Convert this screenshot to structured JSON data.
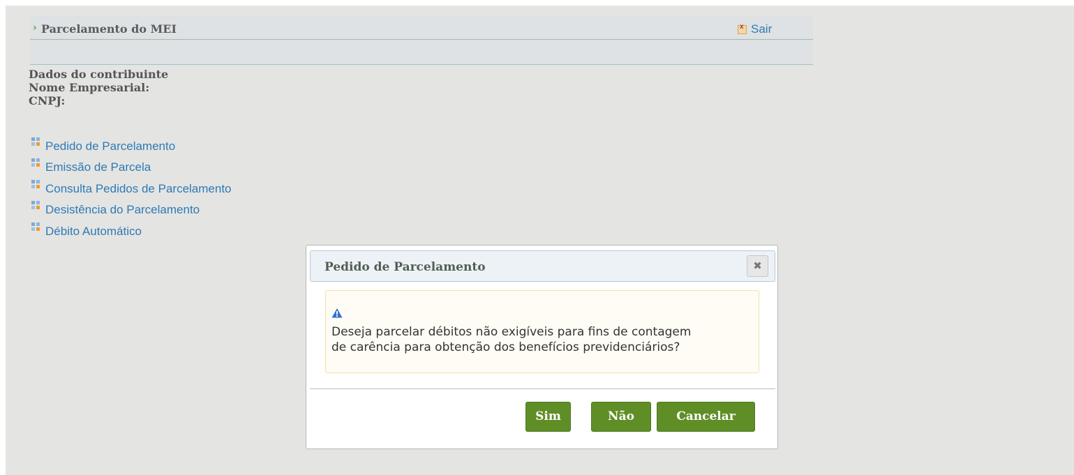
{
  "header": {
    "title": "Parcelamento do MEI",
    "exit_label": "Sair"
  },
  "contributor": {
    "section_title": "Dados do contribuinte",
    "business_name_label": "Nome Empresarial:",
    "cnpj_label": "CNPJ:"
  },
  "menu": {
    "items": [
      {
        "label": "Pedido de Parcelamento",
        "icon": "grid-icon"
      },
      {
        "label": "Emissão de Parcela",
        "icon": "grid-icon"
      },
      {
        "label": "Consulta Pedidos de Parcelamento",
        "icon": "grid-icon"
      },
      {
        "label": "Desistência do Parcelamento",
        "icon": "grid-icon"
      },
      {
        "label": "Débito Automático",
        "icon": "grid-icon"
      }
    ]
  },
  "dialog": {
    "title": "Pedido de Parcelamento",
    "close_icon": "close-icon",
    "warning_icon": "warning-icon",
    "message_line_1": "Deseja parcelar débitos não exigíveis para fins de contagem",
    "message_line_2": "de carência para obtenção dos benefícios previdenciários?",
    "buttons": {
      "yes": "Sim",
      "no": "Não",
      "cancel": "Cancelar"
    }
  },
  "colors": {
    "page_background": "#e4e4e2",
    "link": "#2e7ab6",
    "button_green": "#5f8e27",
    "warning_blue": "#2f6fd6"
  }
}
